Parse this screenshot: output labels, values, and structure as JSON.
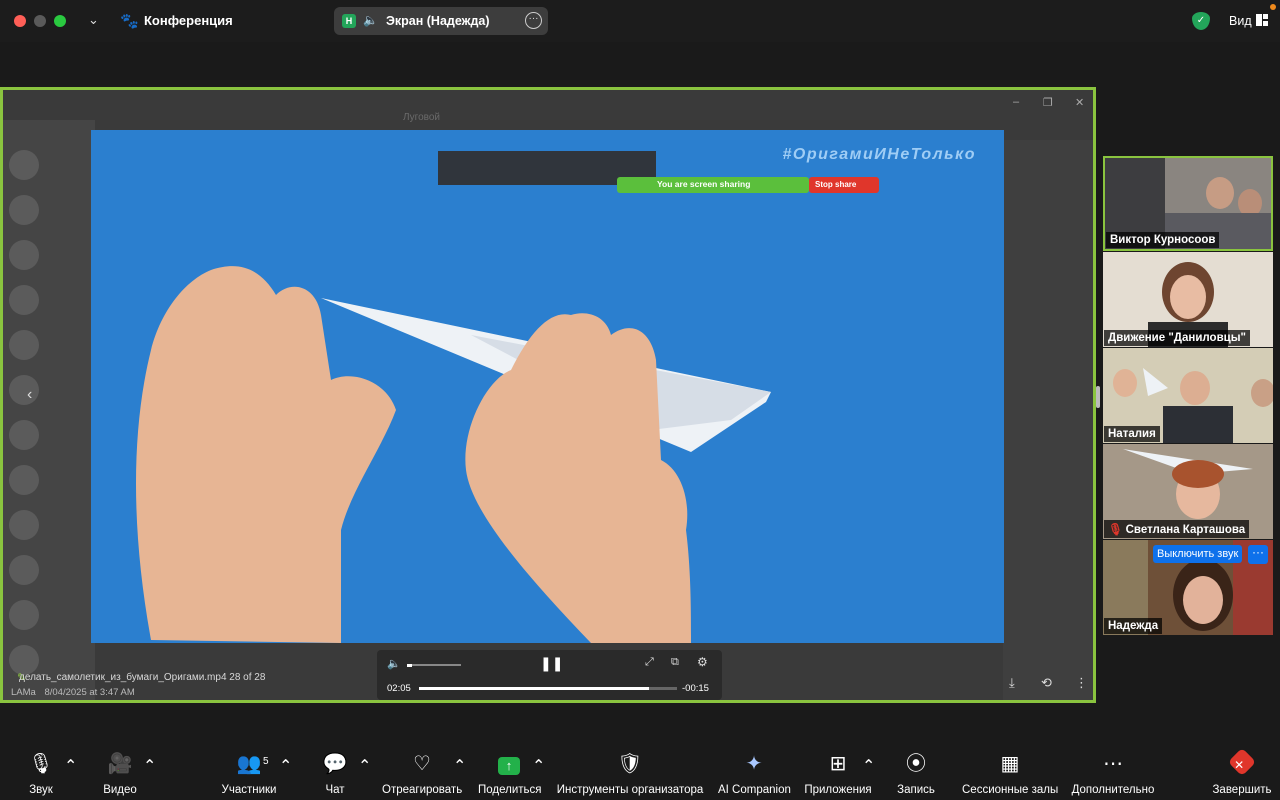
{
  "titlebar": {
    "conference_label": "Конференция",
    "share_pill_badge": "Н",
    "share_pill_label": "Экран (Надежда)",
    "view_label": "Вид"
  },
  "shared_screen": {
    "background_title": "Луговой",
    "video": {
      "hashtag": "#ОригамиИНеТолько",
      "sharing_notice": "You are screen sharing",
      "stop_share": "Stop share"
    },
    "caption": {
      "filename": "делать_самолетик_из_бумаги_Оригами.mp4 28 of 28",
      "author": "LAMa",
      "date": "8/04/2025 at 3:47 AM"
    },
    "player": {
      "elapsed": "02:05",
      "remaining": "-00:15",
      "progress": 0.89,
      "volume": 0.1
    }
  },
  "participants": [
    {
      "name": "Виктор Курносоов",
      "active_speaker": true,
      "muted": false
    },
    {
      "name": "Движение \"Даниловцы\"",
      "active_speaker": false,
      "muted": false
    },
    {
      "name": "Наталия",
      "active_speaker": false,
      "muted": false
    },
    {
      "name": "Светлана Карташова",
      "active_speaker": false,
      "muted": true
    },
    {
      "name": "Надежда",
      "active_speaker": false,
      "muted": false
    }
  ],
  "hover_actions": {
    "mute_label": "Выключить звук",
    "more_label": "···"
  },
  "toolbar": {
    "audio": "Звук",
    "video": "Видео",
    "participants": "Участники",
    "participants_count": "5",
    "chat": "Чат",
    "react": "Отреагировать",
    "share": "Поделиться",
    "host_tools": "Инструменты организатора",
    "ai_companion": "AI Companion",
    "apps": "Приложения",
    "record": "Запись",
    "breakout": "Сессионные залы",
    "more": "Дополнительно",
    "end": "Завершить"
  },
  "colors": {
    "active_border": "#8ac43f",
    "share_green": "#23b14a",
    "end_red": "#e0362b",
    "hover_blue": "#0e71eb",
    "video_blue": "#2b7fcf"
  }
}
